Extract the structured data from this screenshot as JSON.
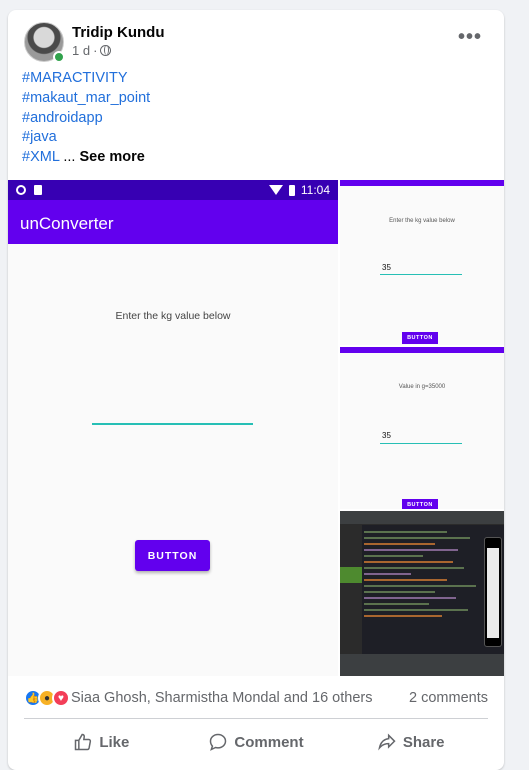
{
  "post": {
    "author": "Tridip Kundu",
    "time": "1 d",
    "separator": "·",
    "more_icon": "•••",
    "hashtags": [
      "#MARACTIVITY",
      "#makaut_mar_point",
      "#androidapp",
      "#java"
    ],
    "last_tag": "#XML",
    "ellipsis": " ... ",
    "see_more": "See more"
  },
  "screenshot_main": {
    "time": "11:04",
    "app_title": "unConverter",
    "prompt": "Enter the kg value below",
    "button": "BUTTON"
  },
  "thumb1": {
    "prompt": "Enter the kg value below",
    "value": "35",
    "button": "BUTTON"
  },
  "thumb2": {
    "prompt": "Value in g=35000",
    "value": "35",
    "button": "BUTTON"
  },
  "stats": {
    "reactions": [
      "like",
      "wow",
      "love"
    ],
    "names": "Siaa Ghosh, Sharmistha Mondal and 16 others",
    "comments": "2 comments"
  },
  "actions": {
    "like": "Like",
    "comment": "Comment",
    "share": "Share"
  },
  "colors": {
    "link": "#216fdb",
    "appbar": "#6200ee",
    "statusbar": "#3700b3",
    "accent_line": "#26bfb5",
    "muted": "#65676b"
  }
}
